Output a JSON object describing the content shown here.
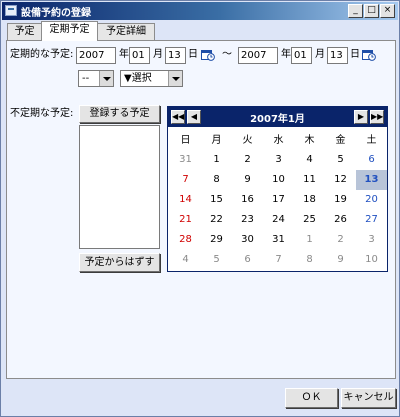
{
  "window": {
    "title": "設備予約の登録"
  },
  "title_buttons": {
    "minimize": "_",
    "maximize": "□",
    "close": "×"
  },
  "tabs": [
    "予定",
    "定期予定",
    "予定詳細"
  ],
  "periodic": {
    "label": "定期的な予定:",
    "start": {
      "year": "2007",
      "month": "01",
      "day": "13"
    },
    "end": {
      "year": "2007",
      "month": "01",
      "day": "13"
    },
    "year_suffix": "年",
    "month_suffix": "月",
    "day_suffix": "日",
    "range_sep": "〜",
    "select1": "--",
    "select2": "▼選択"
  },
  "irregular": {
    "label": "不定期な予定:",
    "register_button": "登録する予定",
    "remove_button": "予定からはずす"
  },
  "calendar": {
    "title": "2007年1月",
    "nav": {
      "prev_year": "◀◀",
      "prev_month": "◀",
      "next_month": "▶",
      "next_year": "▶▶"
    },
    "weekdays": [
      "日",
      "月",
      "火",
      "水",
      "木",
      "金",
      "土"
    ],
    "weeks": [
      [
        "31",
        "1",
        "2",
        "3",
        "4",
        "5",
        "6"
      ],
      [
        "7",
        "8",
        "9",
        "10",
        "11",
        "12",
        "13"
      ],
      [
        "14",
        "15",
        "16",
        "17",
        "18",
        "19",
        "20"
      ],
      [
        "21",
        "22",
        "23",
        "24",
        "25",
        "26",
        "27"
      ],
      [
        "28",
        "29",
        "30",
        "31",
        "1",
        "2",
        "3"
      ],
      [
        "4",
        "5",
        "6",
        "7",
        "8",
        "9",
        "10"
      ]
    ],
    "selected_day": "13",
    "colors": {
      "header": "#0a246a",
      "sunday": "#d00000",
      "saturday": "#2050c0",
      "selected_bg": "#b8c4d8",
      "other_month": "#8a8a8a"
    }
  },
  "footer": {
    "ok": "ＯＫ",
    "cancel": "キャンセル"
  }
}
